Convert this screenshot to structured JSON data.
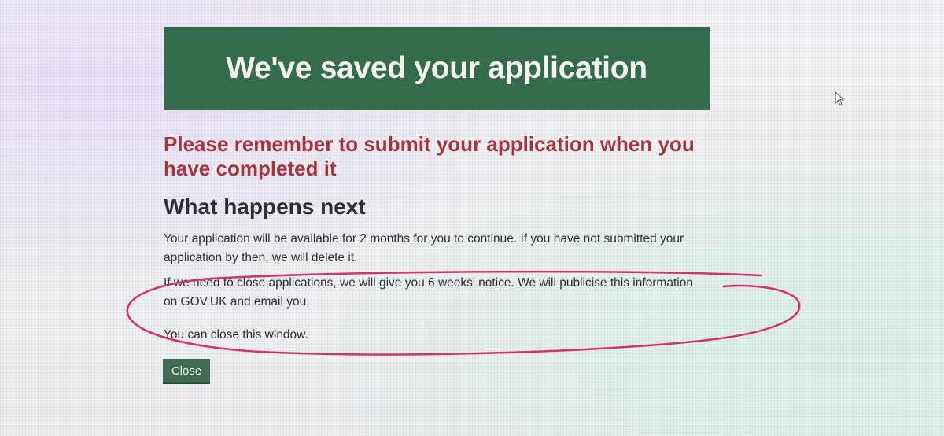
{
  "banner": {
    "title": "We've saved your application"
  },
  "reminder": {
    "text": "Please remember to submit your application when you have completed it"
  },
  "next": {
    "heading": "What happens next",
    "paragraphs": [
      "Your application will be available for 2 months for you to continue. If you have not submitted your application by then, we will delete it.",
      "If we need to close applications, we will give you 6 weeks' notice. We will publicise this information on GOV.UK and email you.",
      "You can close this window."
    ]
  },
  "actions": {
    "close_label": "Close"
  },
  "colors": {
    "banner_green": "#336b4c",
    "reminder_red": "#a5353c",
    "annotation_pink": "#d62f6e",
    "button_green": "#3e6b52"
  },
  "icons": {
    "cursor": "mouse-pointer-icon"
  }
}
